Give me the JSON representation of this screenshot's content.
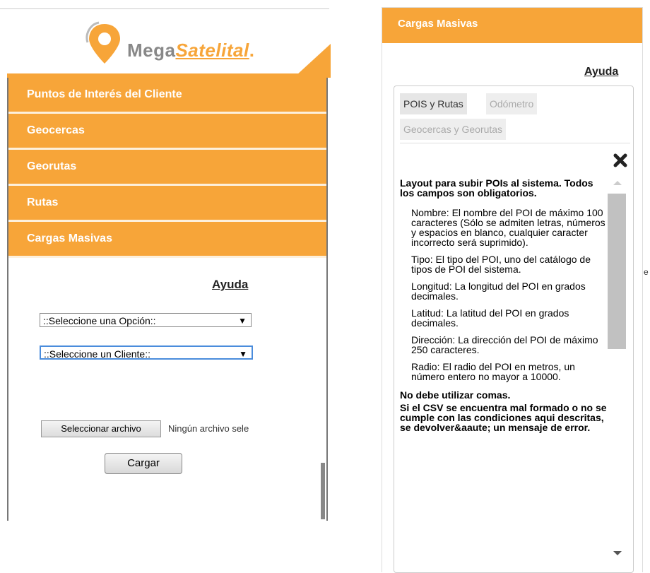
{
  "logo": {
    "brand_plain": "Mega",
    "brand_accent": "Satelital",
    "brand_dot": "."
  },
  "menu": {
    "items": [
      {
        "label": "Puntos de Interés del Cliente"
      },
      {
        "label": "Geocercas"
      },
      {
        "label": "Georutas"
      },
      {
        "label": "Rutas"
      },
      {
        "label": "Cargas Masivas"
      }
    ]
  },
  "cargas": {
    "help_link": "Ayuda",
    "option_select": {
      "value": "::Seleccione una Opción::",
      "arrow": "▼"
    },
    "client_select": {
      "value": "::Seleccione un Cliente::",
      "arrow": "▼"
    },
    "file_button": "Seleccionar archivo",
    "file_status": "Ningún archivo sele",
    "submit": "Cargar"
  },
  "help_panel": {
    "title": "Cargas Masivas",
    "help_link": "Ayuda",
    "tabs": [
      {
        "label": "POIS y Rutas",
        "active": true
      },
      {
        "label": "Odómetro",
        "active": false
      },
      {
        "label": "Geocercas y Georutas",
        "active": false
      }
    ],
    "intro": "Layout para subir POIs al sistema. Todos los campos son obligatorios.",
    "fields": [
      "Nombre: El nombre del POI de máximo 100 caracteres (Sólo se admiten letras, números y espacios en blanco, cualquier caracter incorrecto será suprimido).",
      "Tipo: El tipo del POI, uno del catálogo de tipos de POI del sistema.",
      "Longitud: La longitud del POI en grados decimales.",
      "Latitud: La latitud del POI en grados decimales.",
      "Dirección: La dirección del POI de máximo 250 caracteres.",
      "Radio: El radio del POI en metros, un número entero no mayor a 10000."
    ],
    "warning": "No debe utilizar comas.",
    "warning2": "Si el CSV se encuentra mal formado o no se cumple con las condiciones aqui descritas, se devolver&aaute; un mensaje de error.",
    "stray_char": "e"
  },
  "colors": {
    "accent": "#f7a539"
  }
}
